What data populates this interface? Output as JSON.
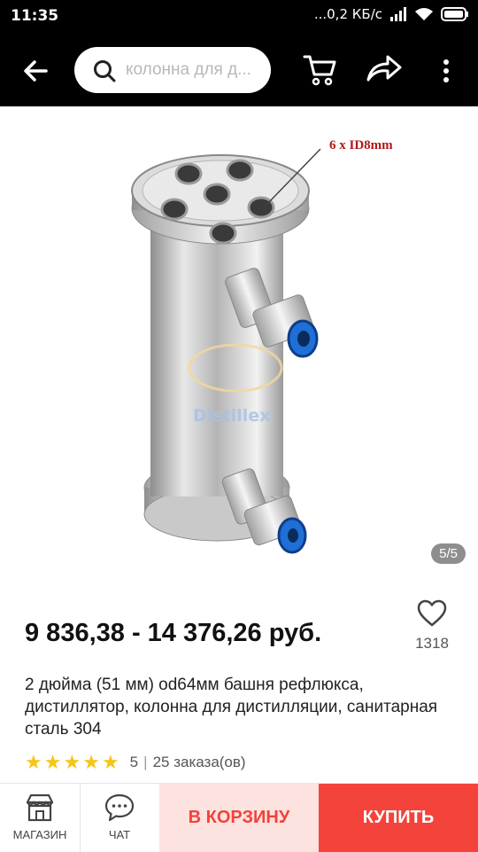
{
  "status_bar": {
    "time": "11:35",
    "network_speed": "...0,2 КБ/с"
  },
  "header": {
    "search_placeholder": "колонна для д...",
    "icons": [
      "back-arrow-icon",
      "search-icon",
      "cart-icon",
      "share-icon",
      "more-vert-icon"
    ]
  },
  "gallery": {
    "annotation": "6 x ID8mm",
    "watermark": "Distillex",
    "counter": "5/5"
  },
  "product": {
    "price": "9 836,38 - 14 376,26 руб.",
    "wishlist_count": "1318",
    "title": "2 дюйма (51 мм) od64мм башня рефлюкса, дистиллятор, колонна для дистилляции, санитарная сталь 304",
    "rating_stars": 5,
    "rating_value": "5",
    "orders": "25 заказа(ов)"
  },
  "bottom_bar": {
    "store_label": "МАГАЗИН",
    "chat_label": "ЧАТ",
    "add_to_cart_label": "В КОРЗИНУ",
    "buy_label": "КУПИТЬ"
  },
  "colors": {
    "accent": "#f4433a",
    "cart_bg": "#fde3e0",
    "star": "#f5c518"
  }
}
